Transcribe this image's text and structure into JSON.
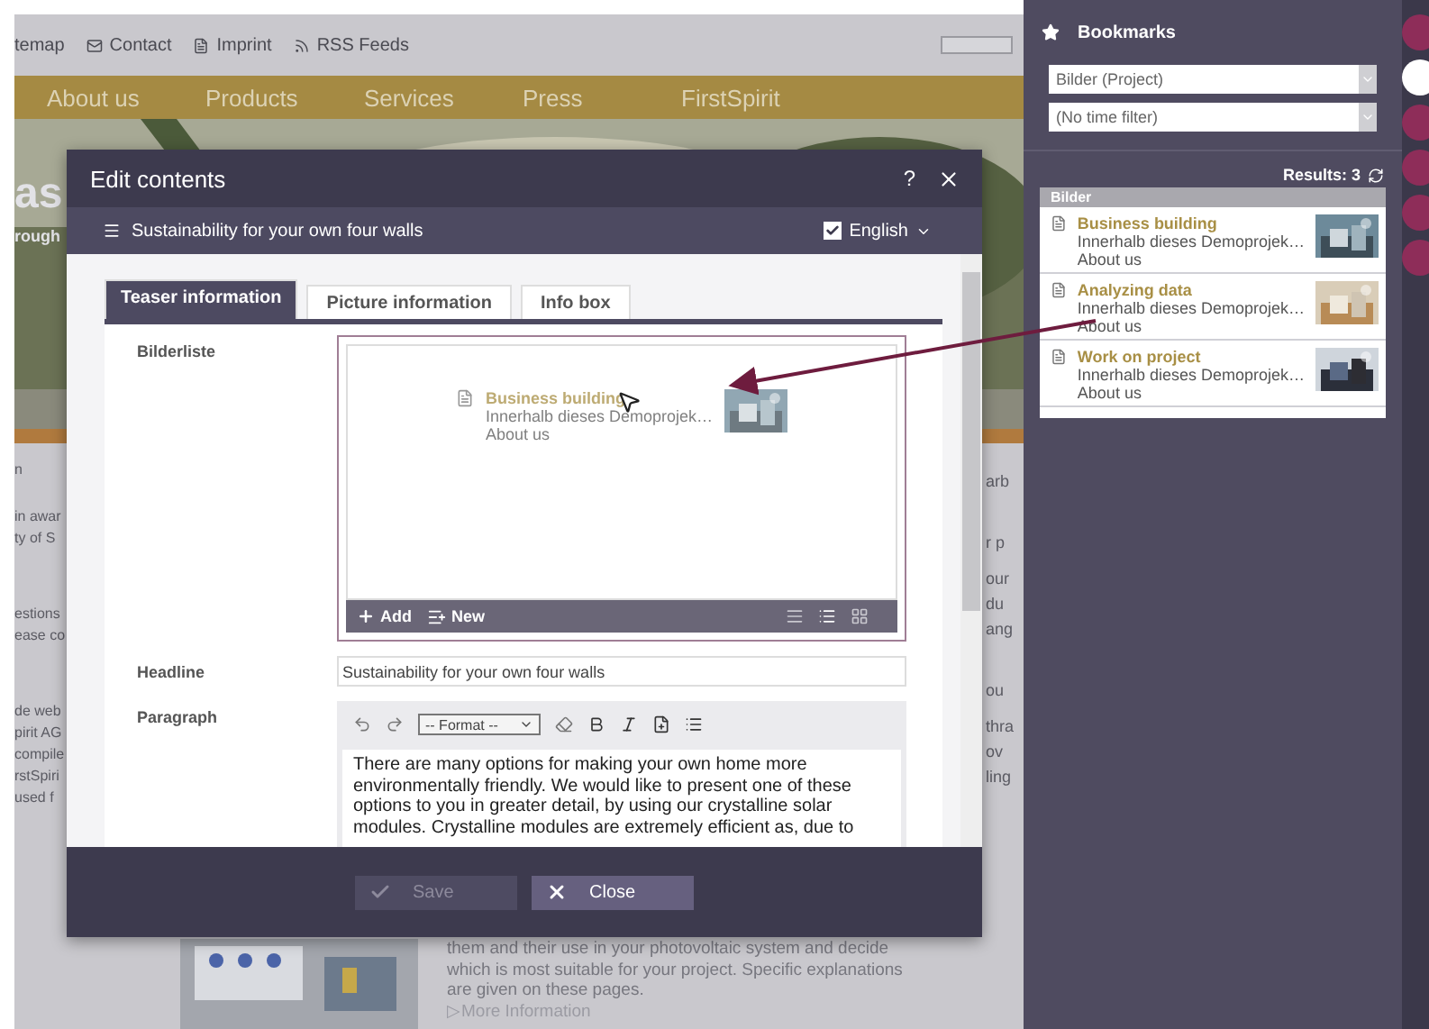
{
  "page": {
    "top_links": [
      {
        "kind": "plain",
        "label": "temap"
      },
      {
        "kind": "mail",
        "label": "Contact"
      },
      {
        "kind": "doc",
        "label": "Imprint"
      },
      {
        "kind": "rss",
        "label": "RSS Feeds"
      }
    ],
    "nav": [
      "About us",
      "Products",
      "Services",
      "Press",
      "FirstSpirit"
    ],
    "hero_text": [
      "as",
      "rough"
    ],
    "left_fragments": [
      "n",
      "in awar",
      "ty of S",
      "estions",
      "ease co",
      "de web",
      "pirit AG",
      "compile",
      "rstSpiri",
      "used f"
    ],
    "right_fragments": [
      "arb",
      "r p",
      "our",
      "du",
      "ang",
      "ou",
      "thra",
      "ov",
      "ling"
    ],
    "teaser": {
      "text": "them and their use in your photovoltaic system and decide\nwhich is most suitable for your project. Specific explanations\nare given on these pages.",
      "link": "▷More Information"
    }
  },
  "dialog": {
    "title": "Edit contents",
    "help": "?",
    "section": "Sustainability for your own four walls",
    "language": {
      "label": "English",
      "checked": true
    },
    "tabs": [
      {
        "label": "Teaser information",
        "selected": true
      },
      {
        "label": "Picture information",
        "selected": false
      },
      {
        "label": "Info box",
        "selected": false
      }
    ],
    "image_list": {
      "label": "Bilderliste",
      "item": {
        "title": "Business building",
        "subtitle": "Innerhalb dieses Demoprojek…",
        "path": "About us"
      },
      "add": "Add",
      "new": "New"
    },
    "headline": {
      "label": "Headline",
      "value": "Sustainability for your own four walls"
    },
    "paragraph": {
      "label": "Paragraph",
      "format": "-- Format --",
      "text": "There are many options for making your own home more\nenvironmentally friendly. We would like to present one of these\noptions to you in greater detail, by using our crystalline solar\nmodules. Crystalline modules are extremely efficient as, due to"
    },
    "buttons": [
      {
        "kind": "save",
        "label": "Save",
        "disabled": true
      },
      {
        "kind": "close",
        "label": "Close",
        "disabled": false
      }
    ]
  },
  "sidebar": {
    "title": "Bookmarks",
    "filters": [
      "Bilder (Project)",
      "(No time filter)"
    ],
    "results": "Results: 3",
    "group": "Bilder",
    "items": [
      {
        "title": "Business building",
        "subtitle": "Innerhalb dieses Demoprojek…",
        "path": "About us"
      },
      {
        "title": "Analyzing data",
        "subtitle": "Innerhalb dieses Demoprojek…",
        "path": "About us"
      },
      {
        "title": "Work on project",
        "subtitle": "Innerhalb dieses Demoprojek…",
        "path": "About us"
      }
    ]
  },
  "rail": [
    {
      "selected": false
    },
    {
      "selected": true
    },
    {
      "selected": false
    },
    {
      "selected": false
    },
    {
      "selected": false
    },
    {
      "selected": false
    }
  ]
}
